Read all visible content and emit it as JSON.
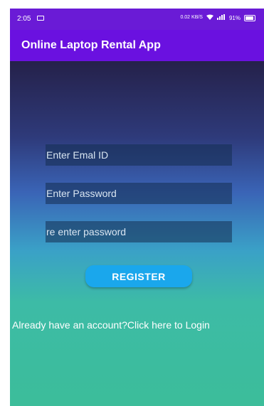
{
  "status_bar": {
    "time": "2:05",
    "data_speed": "0.02 KB/S",
    "battery_percent": "91%"
  },
  "app_bar": {
    "title": "Online Laptop Rental App"
  },
  "form": {
    "email_placeholder": "Enter Emal ID",
    "password_placeholder": "Enter Password",
    "repassword_placeholder": "re enter password",
    "register_label": "REGISTER",
    "login_link": "Already have an account?Click here to Login"
  },
  "colors": {
    "app_bar": "#6a11e0",
    "register_button": "#1aa7ec",
    "gradient_top": "#25214a",
    "gradient_bottom": "#3cbd9a"
  }
}
